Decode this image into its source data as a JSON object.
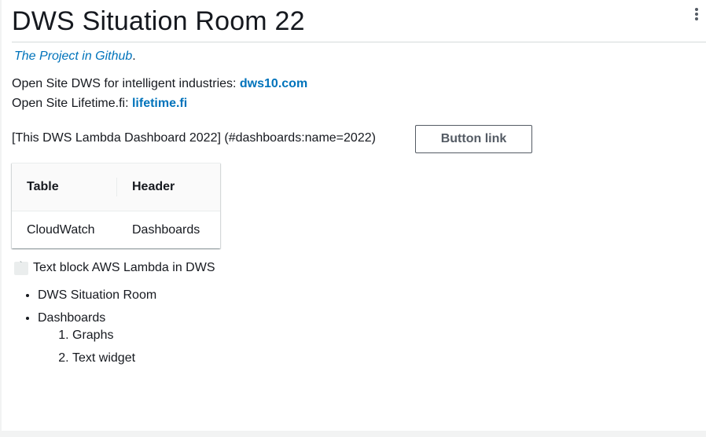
{
  "widget": {
    "title": "DWS Situation Room 22",
    "menu_icon": "vertical-ellipsis-icon"
  },
  "links": {
    "github_text": "The Project in Github",
    "github_suffix": ".",
    "dws_prefix": "Open Site DWS for intelligent industries: ",
    "dws_link": "dws10.com",
    "lifetime_prefix": "Open Site Lifetime.fi: ",
    "lifetime_link": "lifetime.fi"
  },
  "dashboard": {
    "text": "[This DWS Lambda Dashboard 2022] (#dashboards:name=2022)",
    "button_label": "Button link"
  },
  "table": {
    "headers": [
      "Table",
      "Header"
    ],
    "rows": [
      [
        "CloudWatch",
        "Dashboards"
      ]
    ]
  },
  "code_block": {
    "chip": "`",
    "text": "Text block AWS Lambda in DWS"
  },
  "list": {
    "items": [
      "DWS Situation Room",
      "Dashboards"
    ],
    "sub_items": [
      "Graphs",
      "Text widget"
    ]
  },
  "colors": {
    "link": "#0073bb",
    "text": "#16191f",
    "button_border": "#545b64",
    "background": "#f2f3f3"
  }
}
